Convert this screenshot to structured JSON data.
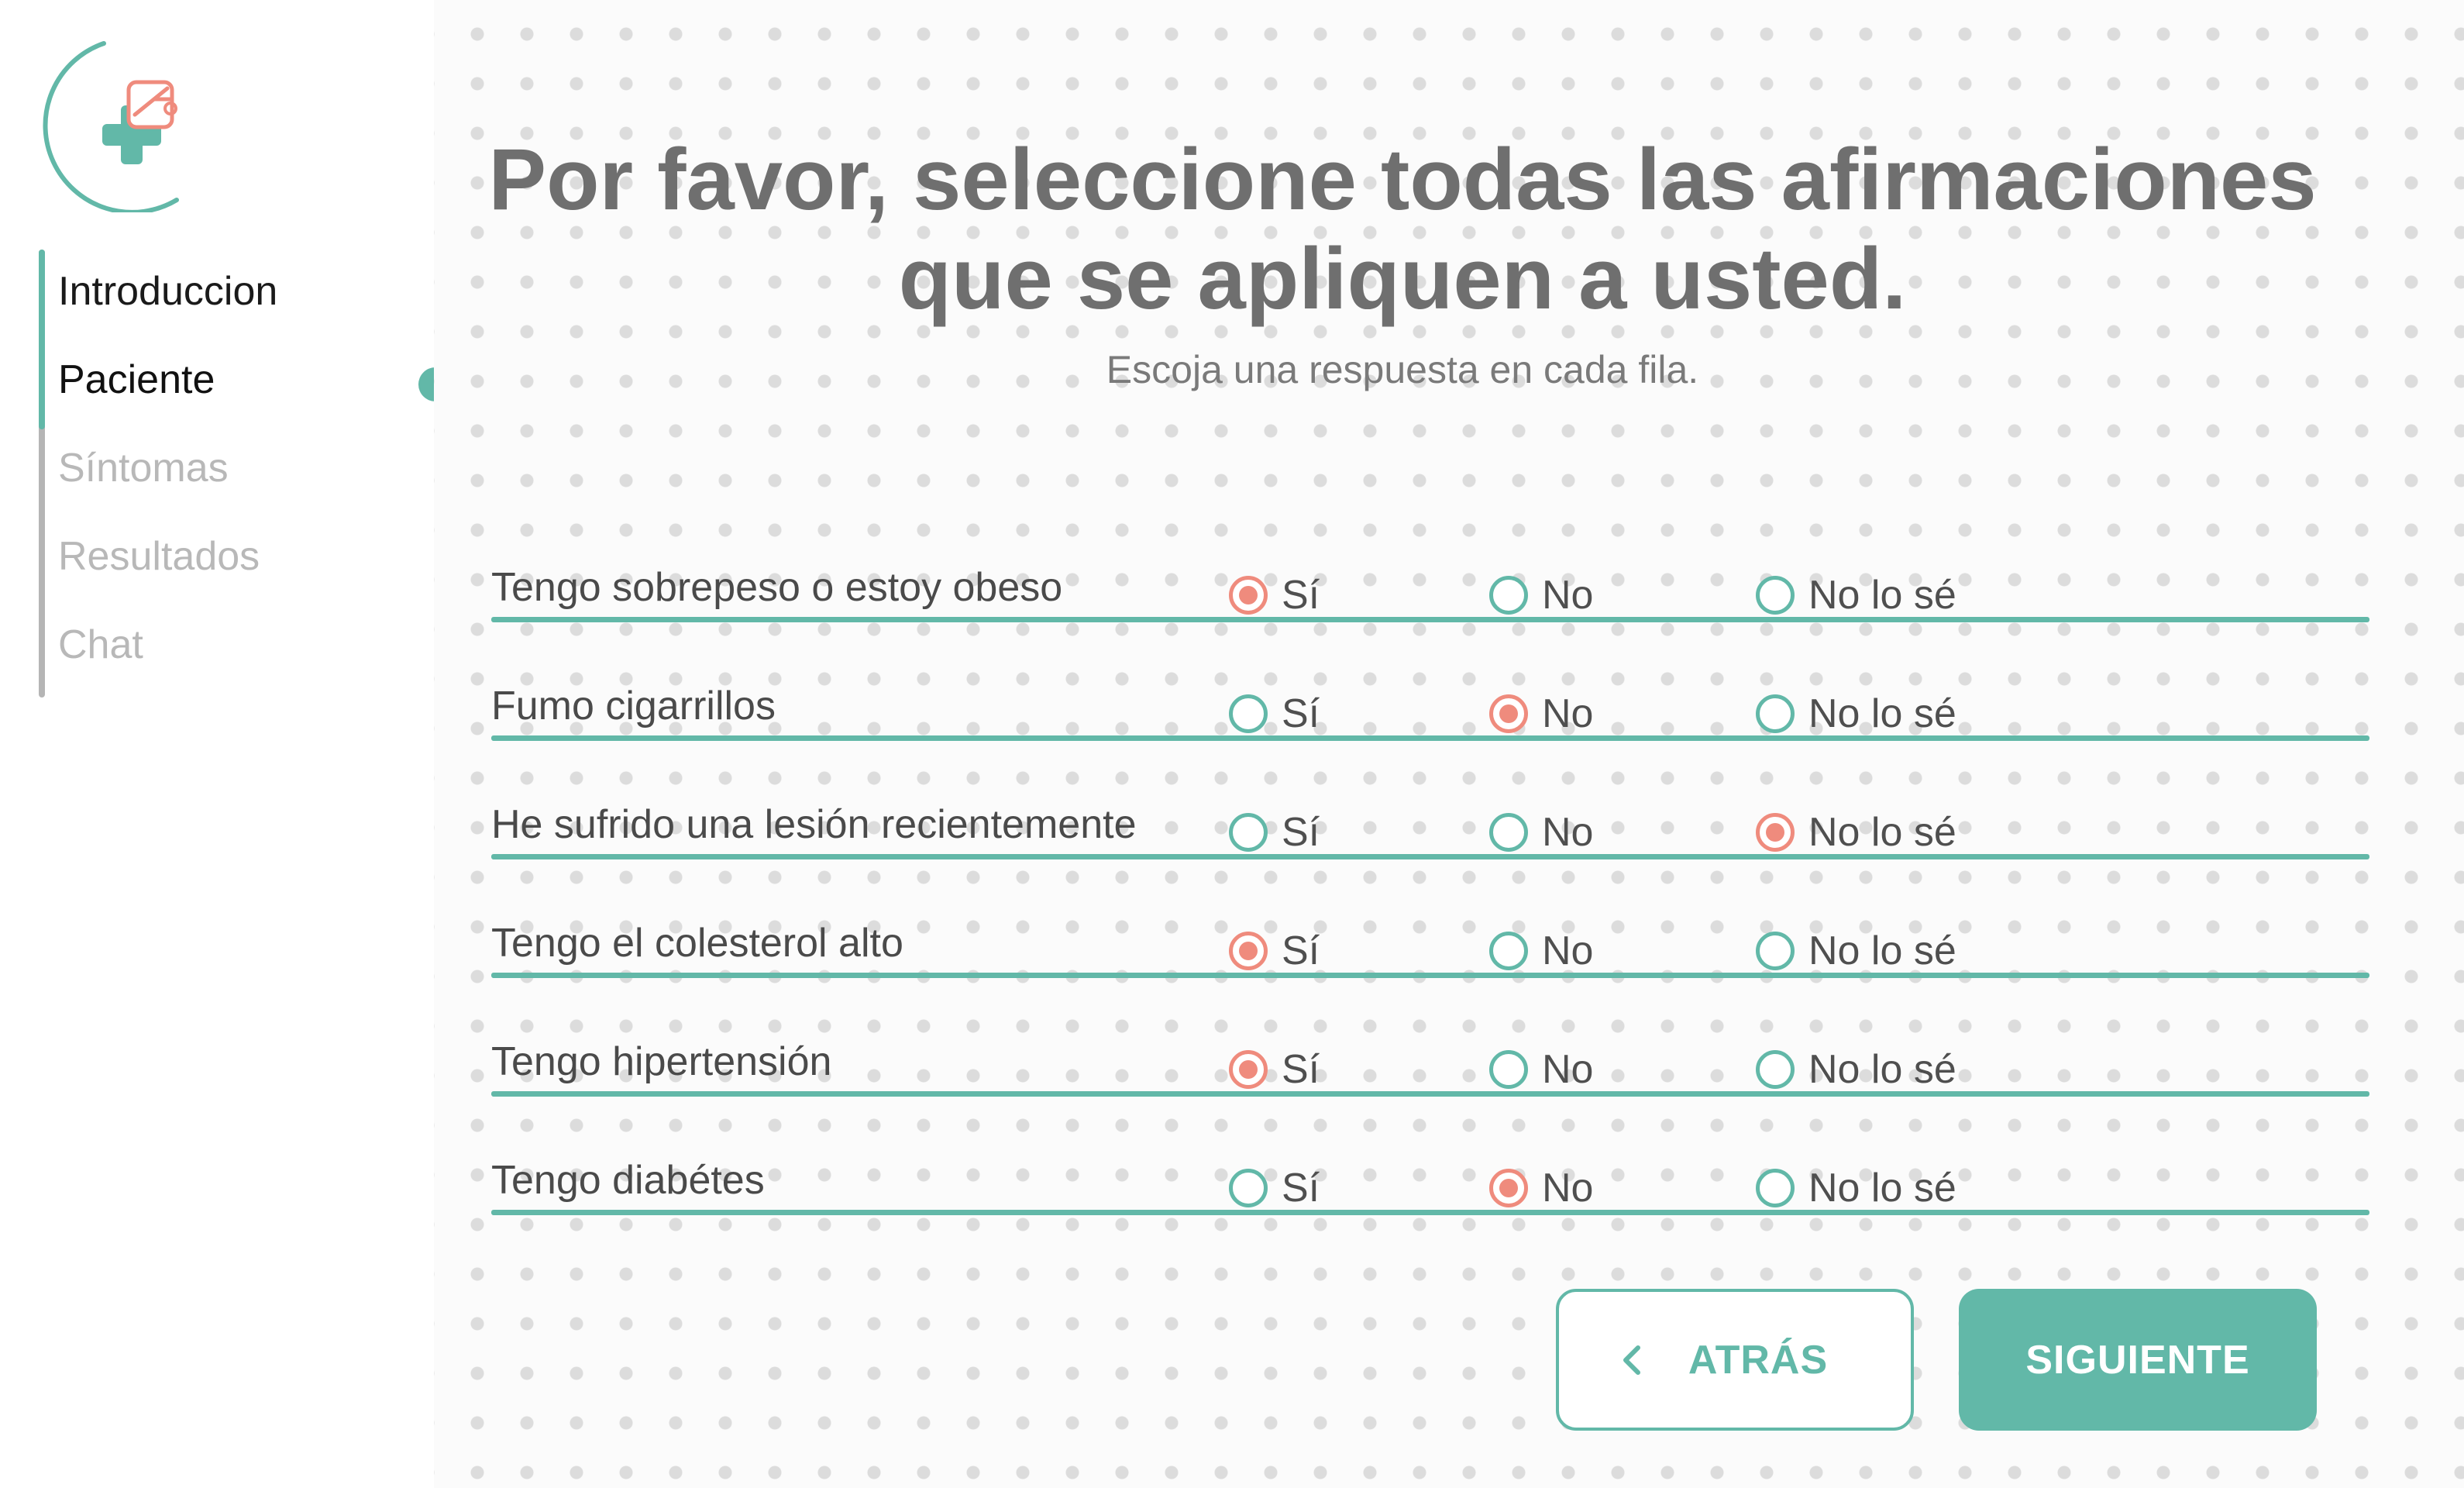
{
  "nav": {
    "items": [
      {
        "label": "Introduccion",
        "state": "done"
      },
      {
        "label": "Paciente",
        "state": "active"
      },
      {
        "label": "Síntomas",
        "state": "todo"
      },
      {
        "label": "Resultados",
        "state": "todo"
      },
      {
        "label": "Chat",
        "state": "todo"
      }
    ]
  },
  "question": {
    "title": "Por favor, seleccione todas las afirmaciones que se apliquen a usted.",
    "subtitle": "Escoja una respuesta en cada fila."
  },
  "options": [
    "Sí",
    "No",
    "No lo sé"
  ],
  "rows": [
    {
      "label": "Tengo sobrepeso o estoy obeso",
      "selected": "Sí"
    },
    {
      "label": "Fumo cigarrillos",
      "selected": "No"
    },
    {
      "label": "He sufrido una lesión recientemente",
      "selected": "No lo sé"
    },
    {
      "label": "Tengo el colesterol alto",
      "selected": "Sí"
    },
    {
      "label": "Tengo hipertensión",
      "selected": "Sí"
    },
    {
      "label": "Tengo diabétes",
      "selected": "No"
    }
  ],
  "buttons": {
    "back": "ATRÁS",
    "next": "SIGUIENTE"
  },
  "colors": {
    "accent": "#62b8a8",
    "selected": "#ef8b7d",
    "title": "#6f6f6f"
  },
  "icons": {
    "logo": "medical-cross-logo",
    "back": "chevron-left-icon"
  }
}
